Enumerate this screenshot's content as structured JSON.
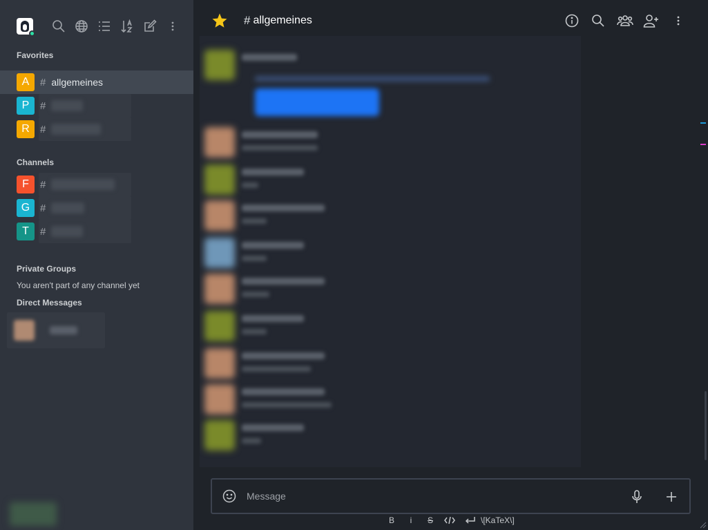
{
  "sidebar": {
    "tools": [
      "search-icon",
      "globe-icon",
      "list-icon",
      "sort-az-icon",
      "edit-icon",
      "kebab-icon"
    ],
    "favorites_title": "Favorites",
    "favorites": [
      {
        "avatar": "A",
        "color": "#f5a800",
        "name": "allgemeines",
        "active": true
      },
      {
        "avatar": "P",
        "color": "#1ab5d1",
        "name": "",
        "active": false
      },
      {
        "avatar": "R",
        "color": "#f5a800",
        "name": "",
        "active": false
      }
    ],
    "channels_title": "Channels",
    "channels": [
      {
        "avatar": "F",
        "color": "#f5522d",
        "name": ""
      },
      {
        "avatar": "G",
        "color": "#1ab5d1",
        "name": ""
      },
      {
        "avatar": "T",
        "color": "#159488",
        "name": ""
      }
    ],
    "hash": "#",
    "private_groups_title": "Private Groups",
    "private_groups_empty": "You aren't part of any channel yet",
    "direct_messages_title": "Direct Messages"
  },
  "header": {
    "hash": "#",
    "title": "allgemeines",
    "star_color": "#f5c518",
    "tools": [
      "info-icon",
      "search-icon",
      "members-icon",
      "add-user-icon",
      "kebab-icon"
    ]
  },
  "composer": {
    "placeholder": "Message"
  },
  "formatting": {
    "bold": "B",
    "italic": "i",
    "strike": "S",
    "katex": "\\[KaTeX\\]"
  },
  "colors": {
    "sidebar_bg": "#2f343d",
    "main_bg": "#1f2329",
    "active_room": "#414852",
    "accent_blue": "#1d74f5"
  }
}
